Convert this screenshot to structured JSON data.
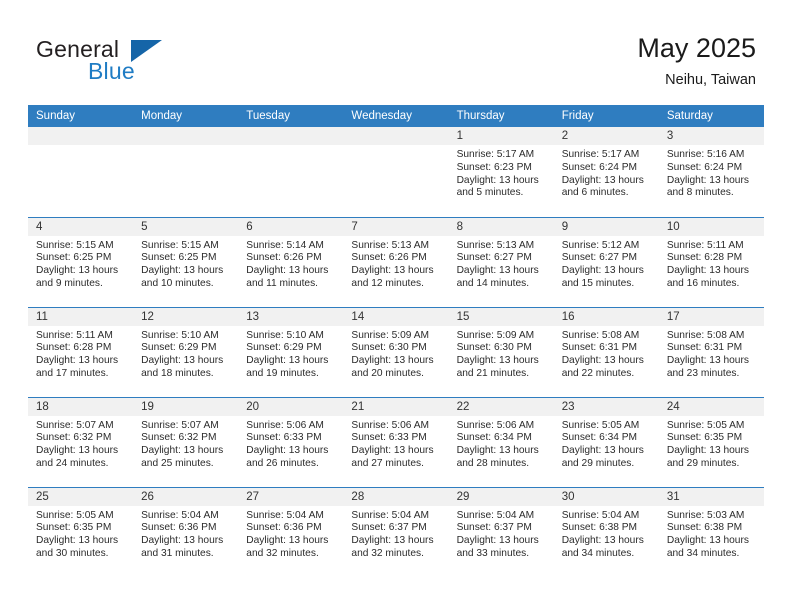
{
  "brand": {
    "line1": "General",
    "line2": "Blue",
    "triangle_color": "#1565a8"
  },
  "header": {
    "title": "May 2025",
    "subtitle": "Neihu, Taiwan",
    "accent_color": "#2f7dc0",
    "daynum_band_color": "#f1f1f1"
  },
  "weekdays": [
    "Sunday",
    "Monday",
    "Tuesday",
    "Wednesday",
    "Thursday",
    "Friday",
    "Saturday"
  ],
  "labels": {
    "sunrise": "Sunrise:",
    "sunset": "Sunset:",
    "daylight": "Daylight:"
  },
  "weeks": [
    [
      {
        "day": "",
        "empty": true
      },
      {
        "day": "",
        "empty": true
      },
      {
        "day": "",
        "empty": true
      },
      {
        "day": "",
        "empty": true
      },
      {
        "day": "1",
        "sunrise": "Sunrise: 5:17 AM",
        "sunset": "Sunset: 6:23 PM",
        "daylight": "Daylight: 13 hours and 5 minutes."
      },
      {
        "day": "2",
        "sunrise": "Sunrise: 5:17 AM",
        "sunset": "Sunset: 6:24 PM",
        "daylight": "Daylight: 13 hours and 6 minutes."
      },
      {
        "day": "3",
        "sunrise": "Sunrise: 5:16 AM",
        "sunset": "Sunset: 6:24 PM",
        "daylight": "Daylight: 13 hours and 8 minutes."
      }
    ],
    [
      {
        "day": "4",
        "sunrise": "Sunrise: 5:15 AM",
        "sunset": "Sunset: 6:25 PM",
        "daylight": "Daylight: 13 hours and 9 minutes."
      },
      {
        "day": "5",
        "sunrise": "Sunrise: 5:15 AM",
        "sunset": "Sunset: 6:25 PM",
        "daylight": "Daylight: 13 hours and 10 minutes."
      },
      {
        "day": "6",
        "sunrise": "Sunrise: 5:14 AM",
        "sunset": "Sunset: 6:26 PM",
        "daylight": "Daylight: 13 hours and 11 minutes."
      },
      {
        "day": "7",
        "sunrise": "Sunrise: 5:13 AM",
        "sunset": "Sunset: 6:26 PM",
        "daylight": "Daylight: 13 hours and 12 minutes."
      },
      {
        "day": "8",
        "sunrise": "Sunrise: 5:13 AM",
        "sunset": "Sunset: 6:27 PM",
        "daylight": "Daylight: 13 hours and 14 minutes."
      },
      {
        "day": "9",
        "sunrise": "Sunrise: 5:12 AM",
        "sunset": "Sunset: 6:27 PM",
        "daylight": "Daylight: 13 hours and 15 minutes."
      },
      {
        "day": "10",
        "sunrise": "Sunrise: 5:11 AM",
        "sunset": "Sunset: 6:28 PM",
        "daylight": "Daylight: 13 hours and 16 minutes."
      }
    ],
    [
      {
        "day": "11",
        "sunrise": "Sunrise: 5:11 AM",
        "sunset": "Sunset: 6:28 PM",
        "daylight": "Daylight: 13 hours and 17 minutes."
      },
      {
        "day": "12",
        "sunrise": "Sunrise: 5:10 AM",
        "sunset": "Sunset: 6:29 PM",
        "daylight": "Daylight: 13 hours and 18 minutes."
      },
      {
        "day": "13",
        "sunrise": "Sunrise: 5:10 AM",
        "sunset": "Sunset: 6:29 PM",
        "daylight": "Daylight: 13 hours and 19 minutes."
      },
      {
        "day": "14",
        "sunrise": "Sunrise: 5:09 AM",
        "sunset": "Sunset: 6:30 PM",
        "daylight": "Daylight: 13 hours and 20 minutes."
      },
      {
        "day": "15",
        "sunrise": "Sunrise: 5:09 AM",
        "sunset": "Sunset: 6:30 PM",
        "daylight": "Daylight: 13 hours and 21 minutes."
      },
      {
        "day": "16",
        "sunrise": "Sunrise: 5:08 AM",
        "sunset": "Sunset: 6:31 PM",
        "daylight": "Daylight: 13 hours and 22 minutes."
      },
      {
        "day": "17",
        "sunrise": "Sunrise: 5:08 AM",
        "sunset": "Sunset: 6:31 PM",
        "daylight": "Daylight: 13 hours and 23 minutes."
      }
    ],
    [
      {
        "day": "18",
        "sunrise": "Sunrise: 5:07 AM",
        "sunset": "Sunset: 6:32 PM",
        "daylight": "Daylight: 13 hours and 24 minutes."
      },
      {
        "day": "19",
        "sunrise": "Sunrise: 5:07 AM",
        "sunset": "Sunset: 6:32 PM",
        "daylight": "Daylight: 13 hours and 25 minutes."
      },
      {
        "day": "20",
        "sunrise": "Sunrise: 5:06 AM",
        "sunset": "Sunset: 6:33 PM",
        "daylight": "Daylight: 13 hours and 26 minutes."
      },
      {
        "day": "21",
        "sunrise": "Sunrise: 5:06 AM",
        "sunset": "Sunset: 6:33 PM",
        "daylight": "Daylight: 13 hours and 27 minutes."
      },
      {
        "day": "22",
        "sunrise": "Sunrise: 5:06 AM",
        "sunset": "Sunset: 6:34 PM",
        "daylight": "Daylight: 13 hours and 28 minutes."
      },
      {
        "day": "23",
        "sunrise": "Sunrise: 5:05 AM",
        "sunset": "Sunset: 6:34 PM",
        "daylight": "Daylight: 13 hours and 29 minutes."
      },
      {
        "day": "24",
        "sunrise": "Sunrise: 5:05 AM",
        "sunset": "Sunset: 6:35 PM",
        "daylight": "Daylight: 13 hours and 29 minutes."
      }
    ],
    [
      {
        "day": "25",
        "sunrise": "Sunrise: 5:05 AM",
        "sunset": "Sunset: 6:35 PM",
        "daylight": "Daylight: 13 hours and 30 minutes."
      },
      {
        "day": "26",
        "sunrise": "Sunrise: 5:04 AM",
        "sunset": "Sunset: 6:36 PM",
        "daylight": "Daylight: 13 hours and 31 minutes."
      },
      {
        "day": "27",
        "sunrise": "Sunrise: 5:04 AM",
        "sunset": "Sunset: 6:36 PM",
        "daylight": "Daylight: 13 hours and 32 minutes."
      },
      {
        "day": "28",
        "sunrise": "Sunrise: 5:04 AM",
        "sunset": "Sunset: 6:37 PM",
        "daylight": "Daylight: 13 hours and 32 minutes."
      },
      {
        "day": "29",
        "sunrise": "Sunrise: 5:04 AM",
        "sunset": "Sunset: 6:37 PM",
        "daylight": "Daylight: 13 hours and 33 minutes."
      },
      {
        "day": "30",
        "sunrise": "Sunrise: 5:04 AM",
        "sunset": "Sunset: 6:38 PM",
        "daylight": "Daylight: 13 hours and 34 minutes."
      },
      {
        "day": "31",
        "sunrise": "Sunrise: 5:03 AM",
        "sunset": "Sunset: 6:38 PM",
        "daylight": "Daylight: 13 hours and 34 minutes."
      }
    ]
  ]
}
